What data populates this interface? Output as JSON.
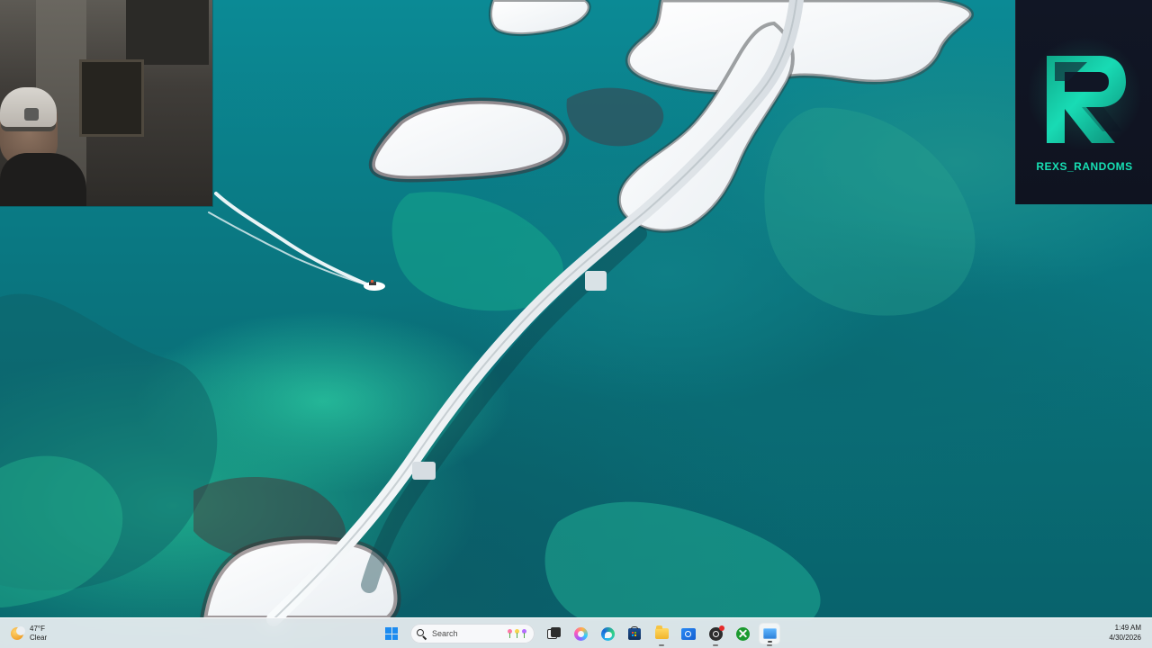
{
  "desktop": {
    "name": "desktop-wallpaper"
  },
  "webcam": {
    "name": "webcam-overlay"
  },
  "branding": {
    "logo_letter": "R",
    "logo_text": "REXS_RANDOMS",
    "accent": "#17E0B4"
  },
  "taskbar": {
    "weather": {
      "temperature": "47°F",
      "condition": "Clear",
      "icon": "moon-icon"
    },
    "search_placeholder": "Search",
    "apps": [
      {
        "name": "start-icon"
      },
      {
        "name": "search-icon"
      },
      {
        "name": "task-view-icon"
      },
      {
        "name": "copilot-icon"
      },
      {
        "name": "edge-icon"
      },
      {
        "name": "microsoft-store-icon"
      },
      {
        "name": "file-explorer-icon"
      },
      {
        "name": "outlook-icon"
      },
      {
        "name": "obs-icon"
      },
      {
        "name": "xbox-icon"
      },
      {
        "name": "remote-desktop-icon"
      }
    ],
    "time": "1:49 AM",
    "date": "4/30/2026"
  },
  "colors": {
    "water_primary": "#0A7680",
    "water_highlight": "#25B99A",
    "snow": "#F3F6F8",
    "taskbar": "#EBEFF2"
  }
}
